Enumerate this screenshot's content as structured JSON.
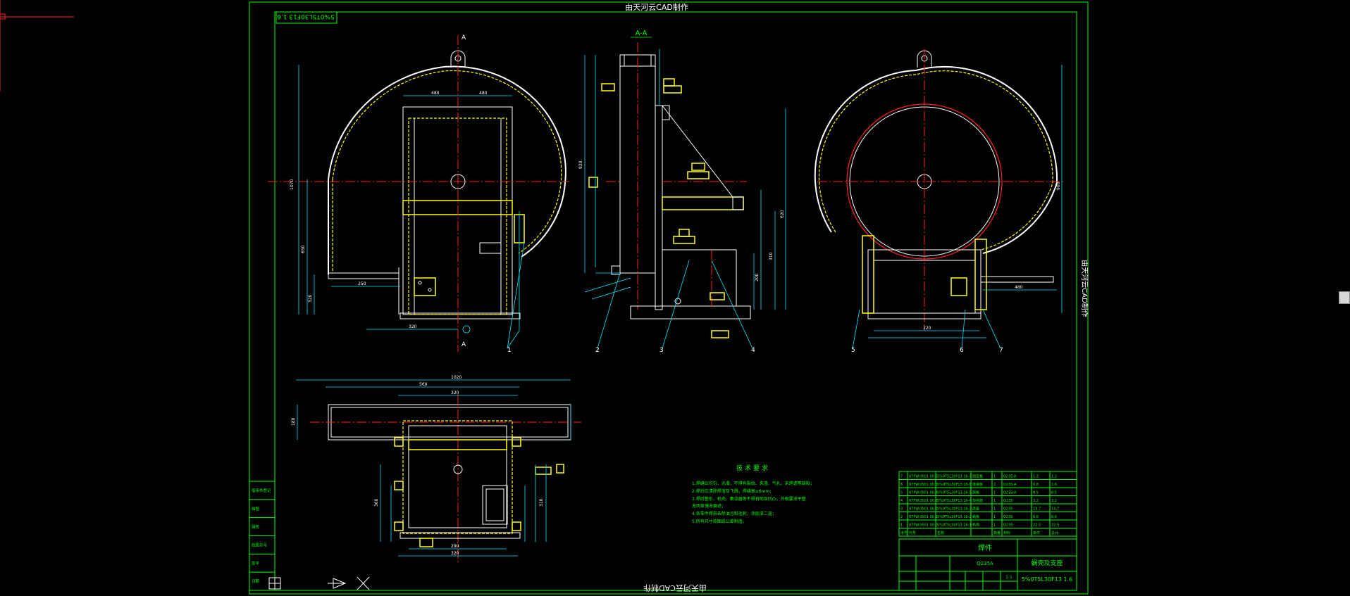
{
  "watermark_top": "由天河云CAD制作",
  "watermark_bottom": "由天河云CAD制作",
  "watermark_right": "由天河云CAD制作",
  "drawing_number_stamp": "5%0T5L30F13 1.6",
  "section_label": "A-A",
  "section_markers": [
    "A",
    "A"
  ],
  "tech_req": {
    "title": "技术要求",
    "lines": [
      "1.焊缝应均匀、光滑，不得有裂纹、夹渣、气孔、未焊透等缺陷；",
      "2.焊后应清除焊渣及飞溅，焊缝高≥6mm；",
      "3.焊后整形，机壳、集流器等不得有明显凹凸，外观要求平整",
      "  无明显锤击痕迹；",
      "4.各零件焊前去除油污和毛刺，涂底漆二道；",
      "5.所有尺寸按图纸公差制造。"
    ]
  },
  "title_block": {
    "part_name": "焊件",
    "assembly_name": "蜗壳及支座",
    "drawing_code": "5%0T5L30F13 1.6",
    "material_code": "Q235A",
    "scale": "1:1"
  },
  "parts_list": [
    {
      "no": "7",
      "code": "07FW.0501 00.6",
      "name": "5%0T5L30F13.16-7",
      "desc": "固定板",
      "qty": "1",
      "mat": "Q235-A",
      "wt": "1.2",
      "sum": "1.2"
    },
    {
      "no": "6",
      "code": "07FW.0501 00.5",
      "name": "5%0T5L30F13.16-6",
      "desc": "连接板",
      "qty": "2",
      "mat": "Q235-A",
      "wt": "0.8",
      "sum": "1.6"
    },
    {
      "no": "5",
      "code": "07FW.0501 00.4",
      "name": "5%0T5L30F13.16-5",
      "desc": "侧板",
      "qty": "1",
      "mat": "Q235-A",
      "wt": "8.5",
      "sum": "8.5"
    },
    {
      "no": "4",
      "code": "07FW.0501 00.3",
      "name": "5%0T5L30F13.16-4",
      "desc": "加强筋",
      "qty": "1",
      "mat": "Q235",
      "wt": "3.2",
      "sum": "3.2"
    },
    {
      "no": "3",
      "code": "07FW.0501 00.2",
      "name": "5%0T5L30F13.16-3",
      "desc": "底座",
      "qty": "1",
      "mat": "Q235",
      "wt": "14.7",
      "sum": "14.7"
    },
    {
      "no": "2",
      "code": "07FW.0501 00.1",
      "name": "5%0T5L30F13.16-2",
      "desc": "蜗板",
      "qty": "1",
      "mat": "Q235",
      "wt": "6.6",
      "sum": "6.6"
    },
    {
      "no": "1",
      "code": "07FW.0501 00.0",
      "name": "5%0T5L30F13.16-1",
      "desc": "机壳",
      "qty": "1",
      "mat": "Q235",
      "wt": "22.5",
      "sum": "22.5"
    }
  ],
  "parts_header": [
    "序号",
    "代号",
    "名称",
    "数量",
    "材料",
    "单件",
    "总计"
  ],
  "left_strip": [
    "借用件登记",
    "描图",
    "描校",
    "底图总号",
    "签字",
    "日期"
  ],
  "balloons": [
    "1",
    "2",
    "3",
    "4",
    "5",
    "6",
    "7"
  ],
  "colors": {
    "frame": "#00ff00",
    "geometry": "#ffffff",
    "centerline": "#ff2020",
    "hidden": "#ffff00",
    "dimension": "#00e5ff",
    "annotation": "#ffff80",
    "background": "#000000"
  }
}
